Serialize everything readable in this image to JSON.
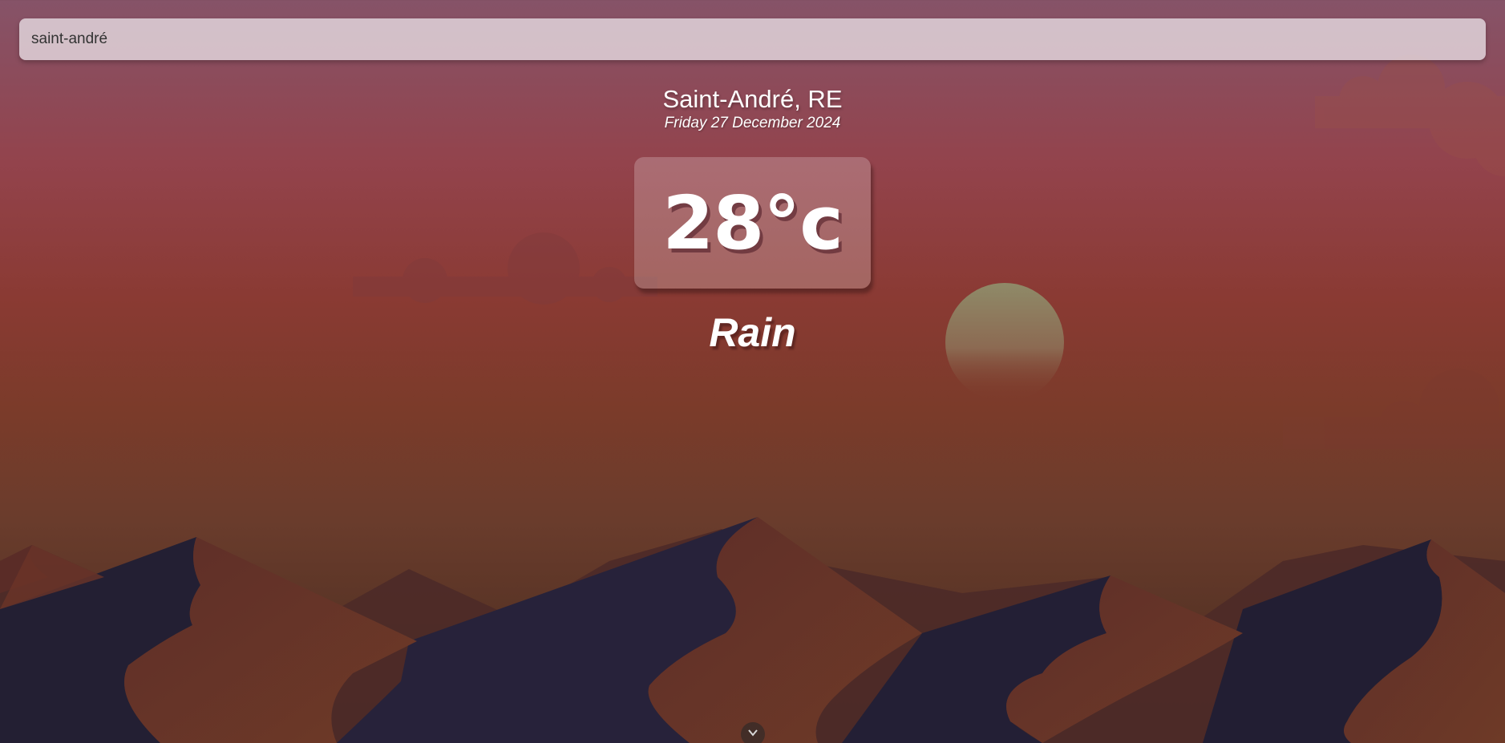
{
  "search": {
    "value": "saint-andré",
    "placeholder": ""
  },
  "weather": {
    "location": "Saint-André, RE",
    "date": "Friday 27 December 2024",
    "temperature": "28°c",
    "condition": "Rain"
  },
  "footer": {
    "scroll_icon": "chevron-down-icon"
  },
  "colors": {
    "sky_top": "#865368",
    "sky_mid": "#93434c",
    "dune_dark": "#1f1c30",
    "dune_light": "#6b3528",
    "sun": "#8f8668"
  }
}
